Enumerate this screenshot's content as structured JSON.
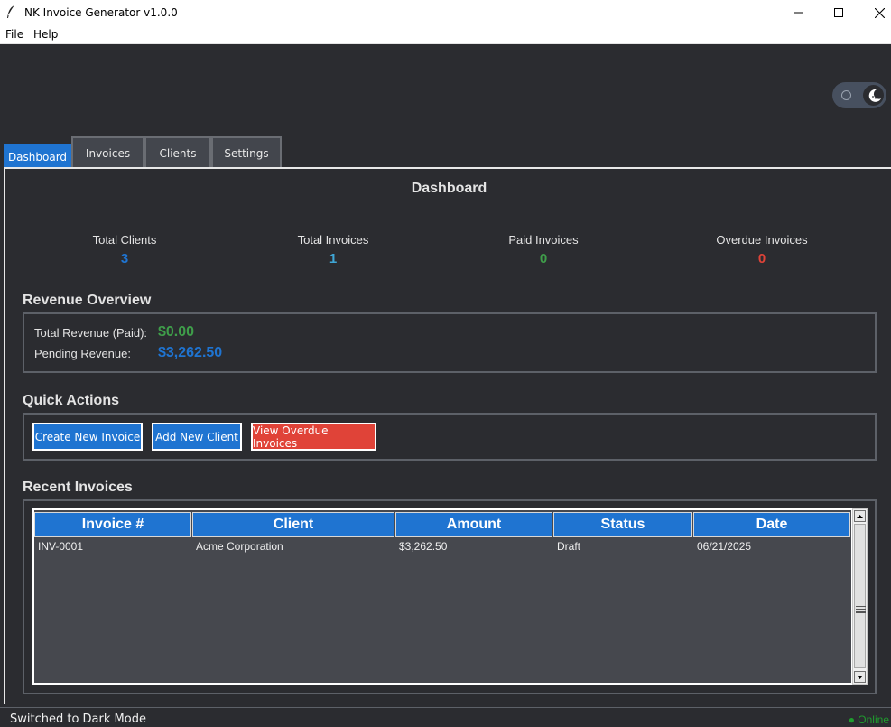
{
  "window": {
    "title": "NK Invoice Generator v1.0.0"
  },
  "menu": {
    "file": "File",
    "help": "Help"
  },
  "tabs": [
    {
      "label": "Dashboard",
      "active": true
    },
    {
      "label": "Invoices",
      "active": false
    },
    {
      "label": "Clients",
      "active": false
    },
    {
      "label": "Settings",
      "active": false
    }
  ],
  "dashboard": {
    "title": "Dashboard",
    "stats": [
      {
        "label": "Total Clients",
        "value": "3",
        "color": "#1f74d1"
      },
      {
        "label": "Total Invoices",
        "value": "1",
        "color": "#3fa7d6"
      },
      {
        "label": "Paid Invoices",
        "value": "0",
        "color": "#3f9e4a"
      },
      {
        "label": "Overdue Invoices",
        "value": "0",
        "color": "#e04338"
      }
    ],
    "revenue": {
      "title": "Revenue Overview",
      "paid_label": "Total Revenue (Paid):",
      "paid_value": "$0.00",
      "pending_label": "Pending Revenue:",
      "pending_value": "$3,262.50"
    },
    "quick_actions": {
      "title": "Quick Actions",
      "create_invoice": "Create New Invoice",
      "add_client": "Add New Client",
      "view_overdue": "View Overdue Invoices"
    },
    "recent": {
      "title": "Recent Invoices",
      "columns": [
        "Invoice #",
        "Client",
        "Amount",
        "Status",
        "Date"
      ],
      "rows": [
        [
          "INV-0001",
          "Acme Corporation",
          "$3,262.50",
          "Draft",
          "06/21/2025"
        ]
      ]
    }
  },
  "status": {
    "message": "Switched to Dark Mode",
    "connection": "● Online"
  },
  "colors": {
    "accent": "#1f74d1",
    "danger": "#e04338",
    "success": "#3f9e4a",
    "background": "#2b2c30"
  }
}
